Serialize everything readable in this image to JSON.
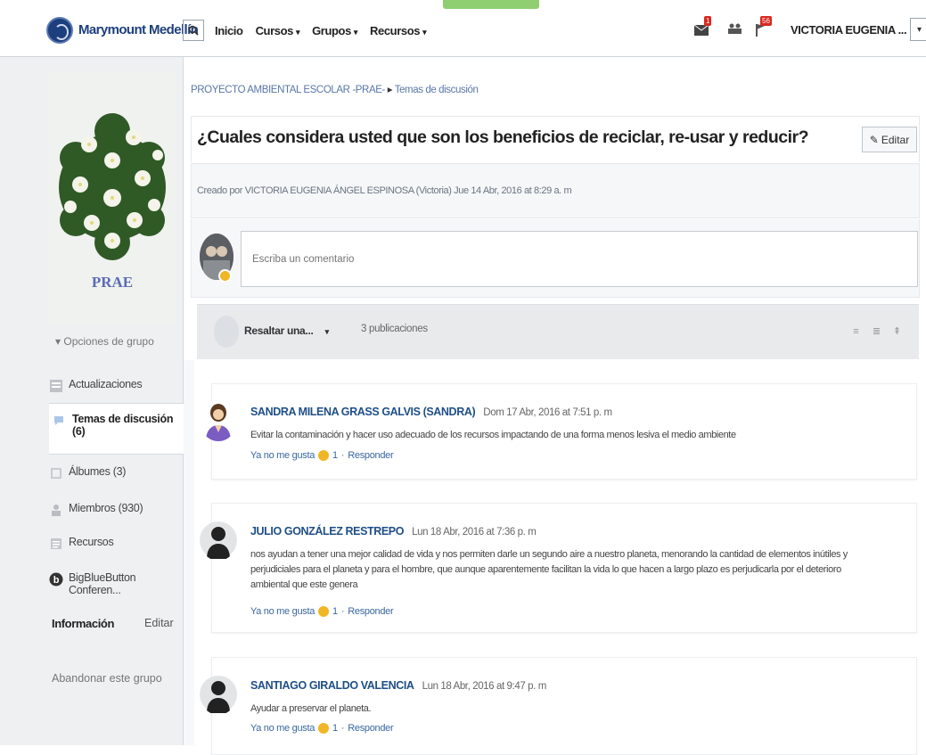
{
  "topbar": {
    "brand": "Marymount Medellín",
    "nav": [
      {
        "label": "Inicio",
        "caret": false
      },
      {
        "label": "Cursos",
        "caret": true
      },
      {
        "label": "Grupos",
        "caret": true
      },
      {
        "label": "Recursos",
        "caret": true
      }
    ],
    "messages_badge": "1",
    "notifications_badge": "56",
    "user_name": "VICTORIA EUGENIA ..."
  },
  "sidebar": {
    "group_image_text": "PRAE",
    "group_options": "▾ Opciones de grupo",
    "items": [
      {
        "label": "Actualizaciones"
      },
      {
        "label": "Temas de discusión (6)"
      },
      {
        "label": "Álbumes (3)"
      },
      {
        "label": "Miembros (930)"
      },
      {
        "label": "Recursos"
      },
      {
        "label": "BigBlueButton Conferen..."
      }
    ],
    "info_label": "Información",
    "info_edit": "Editar",
    "leave": "Abandonar este grupo"
  },
  "main": {
    "breadcrumb_group": "PROYECTO AMBIENTAL ESCOLAR -PRAE-",
    "breadcrumb_sep": "▸",
    "breadcrumb_section": "Temas de discusión",
    "title": "¿Cuales considera usted que son los beneficios de reciclar, re-usar y reducir?",
    "edit_label": "Editar",
    "meta": "Creado por VICTORIA EUGENIA ÁNGEL ESPINOSA (Victoria) Jue 14 Abr, 2016 at 8:29 a. m",
    "comment_placeholder": "Escriba un comentario",
    "highlight_label": "Resaltar una...",
    "pub_count": "3 publicaciones"
  },
  "posts": [
    {
      "author": "SANDRA MILENA GRASS GALVIS (SANDRA)",
      "date": "Dom 17 Abr, 2016 at 7:51 p. m",
      "body": "Evitar la contaminación y hacer uso adecuado de los recursos impactando de una forma menos lesiva el medio ambiente",
      "actions": "Ya no me gusta",
      "likes": "1",
      "reply": "Responder"
    },
    {
      "author": "JULIO GONZÁLEZ RESTREPO",
      "date": "Lun 18 Abr, 2016 at 7:36 p. m",
      "body": "nos ayudan a tener una mejor calidad de vida y nos permiten darle un segundo aire a nuestro planeta, menorando la cantidad de elementos inútiles y perjudiciales para el planeta y para el hombre, que aunque aparentemente facilitan la vida lo que hacen a largo plazo es perjudicarla por el deterioro ambiental que este genera",
      "actions": "Ya no me gusta",
      "likes": "1",
      "reply": "Responder"
    },
    {
      "author": "SANTIAGO GIRALDO VALENCIA",
      "date": "Lun 18 Abr, 2016 at 9:47 p. m",
      "body": "Ayudar a preservar el planeta.",
      "actions": "Ya no me gusta",
      "likes": "1",
      "reply": "Responder"
    }
  ]
}
